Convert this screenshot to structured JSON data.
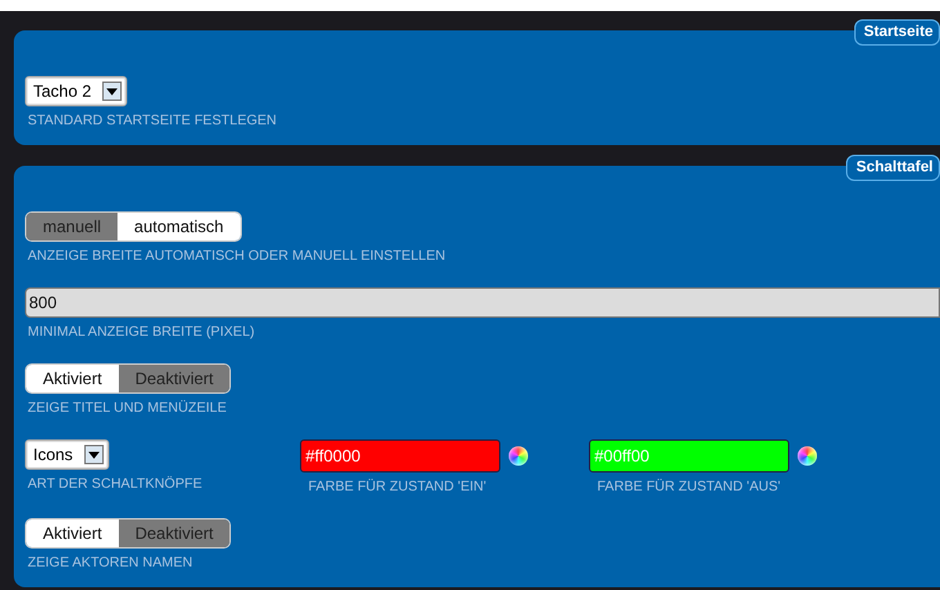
{
  "sections": [
    {
      "title": "Startseite",
      "settings": [
        {
          "kind": "select",
          "value": "Tacho 2",
          "label": "STANDARD STARTSEITE FESTLEGEN"
        }
      ]
    },
    {
      "title": "Schalttafel",
      "settings": [
        {
          "kind": "toggle",
          "options": [
            {
              "label": "manuell",
              "selected": false
            },
            {
              "label": "automatisch",
              "selected": true
            }
          ],
          "label": "ANZEIGE BREITE AUTOMATISCH ODER MANUELL EINSTELLEN"
        },
        {
          "kind": "text",
          "value": "800",
          "label": "MINIMAL ANZEIGE BREITE (PIXEL)"
        },
        {
          "kind": "toggle",
          "options": [
            {
              "label": "Aktiviert",
              "selected": true
            },
            {
              "label": "Deaktiviert",
              "selected": false
            }
          ],
          "label": "ZEIGE TITEL UND MENÜZEILE"
        },
        {
          "kind": "row",
          "items": [
            {
              "kind": "select",
              "value": "Icons",
              "label": "ART DER SCHALTKNÖPFE"
            },
            {
              "kind": "color",
              "value": "#ff0000",
              "color": "#ff0000",
              "label": "FARBE FÜR ZUSTAND 'EIN'"
            },
            {
              "kind": "color",
              "value": "#00ff00",
              "color": "#00ff00",
              "label": "FARBE FÜR ZUSTAND 'AUS'"
            }
          ]
        },
        {
          "kind": "toggle",
          "options": [
            {
              "label": "Aktiviert",
              "selected": true
            },
            {
              "label": "Deaktiviert",
              "selected": false
            }
          ],
          "label": "ZEIGE AKTOREN NAMEN"
        }
      ]
    }
  ]
}
